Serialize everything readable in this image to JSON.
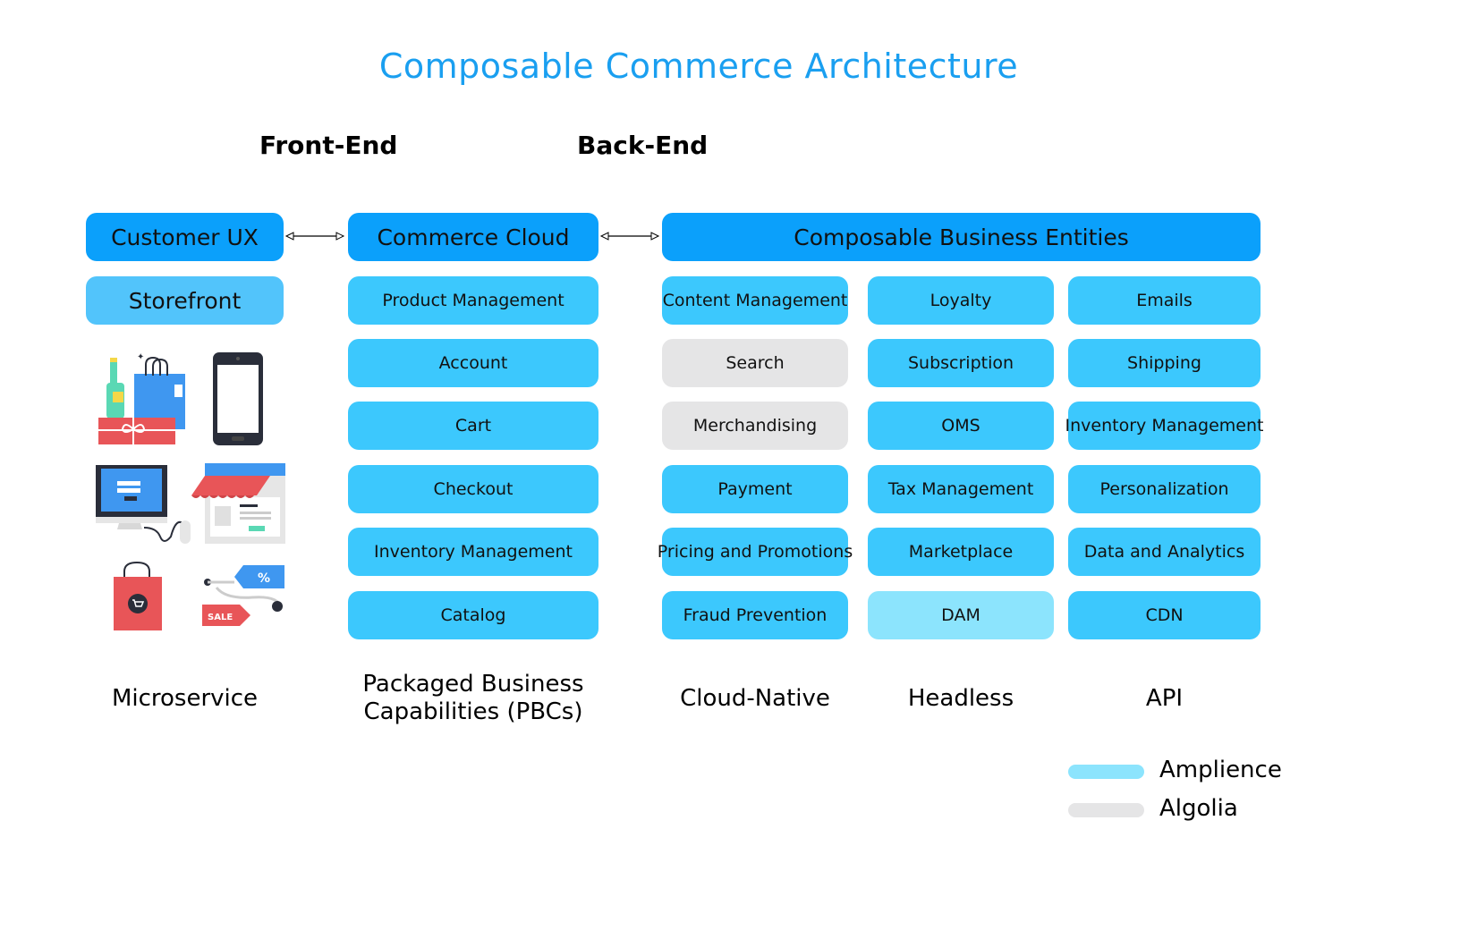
{
  "title": "Composable Commerce Architecture",
  "sections": {
    "front_end": "Front-End",
    "back_end": "Back-End"
  },
  "columns": {
    "customer_ux": {
      "header": "Customer UX",
      "items": [
        "Storefront"
      ],
      "label": "Microservice"
    },
    "commerce_cloud": {
      "header": "Commerce Cloud",
      "items": [
        "Product Management",
        "Account",
        "Cart",
        "Checkout",
        "Inventory Management",
        "Catalog"
      ],
      "label_line1": "Packaged Business",
      "label_line2": "Capabilities (PBCs)"
    },
    "composable_entities": {
      "header": "Composable Business Entities",
      "col1": {
        "items": [
          "Content Management",
          "Search",
          "Merchandising",
          "Payment",
          "Pricing and Promotions",
          "Fraud Prevention"
        ],
        "label": "Cloud-Native"
      },
      "col2": {
        "items": [
          "Loyalty",
          "Subscription",
          "OMS",
          "Tax Management",
          "Marketplace",
          "DAM"
        ],
        "label": "Headless"
      },
      "col3": {
        "items": [
          "Emails",
          "Shipping",
          "Inventory Management",
          "Personalization",
          "Data and Analytics",
          "CDN"
        ],
        "label": "API"
      }
    }
  },
  "highlights": {
    "amplience": [
      "DAM"
    ],
    "algolia": [
      "Search",
      "Merchandising"
    ]
  },
  "legend": [
    {
      "label": "Amplience",
      "color": "#8ce4fd"
    },
    {
      "label": "Algolia",
      "color": "#e5e5e6"
    }
  ],
  "colors": {
    "title": "#1a9ff0",
    "header_box": "#0ba0fb",
    "storefront_box": "#52c4fb",
    "item_box": "#3cc8fd",
    "amplience": "#8ce4fd",
    "algolia": "#e5e5e6"
  },
  "illustrations": [
    "shopping-gifts-icon",
    "smartphone-icon",
    "desktop-computer-icon",
    "storefront-shop-icon",
    "shopping-bag-cart-icon",
    "sale-tags-icon"
  ]
}
